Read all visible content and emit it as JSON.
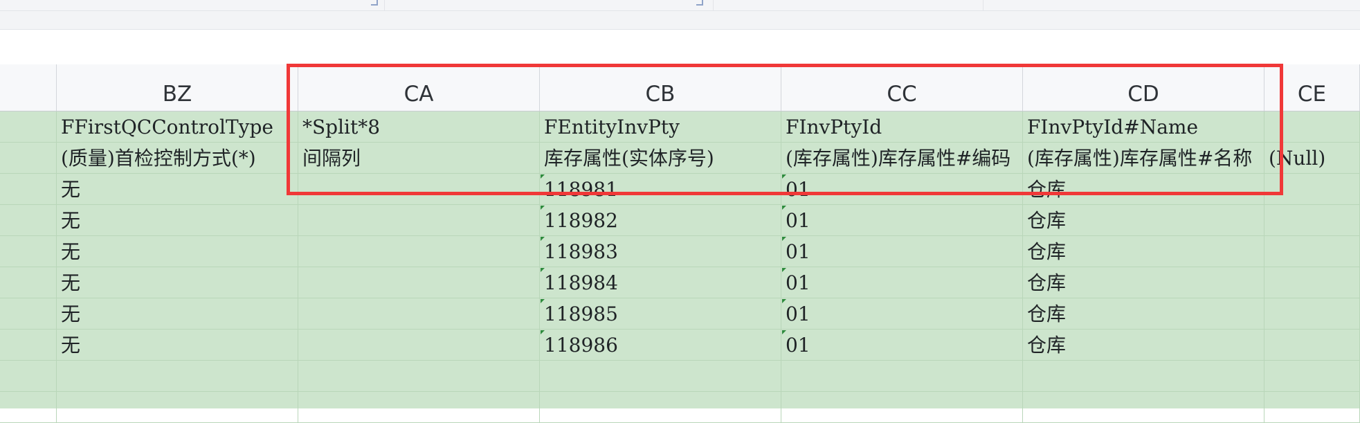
{
  "columns": [
    {
      "letter": "BZ"
    },
    {
      "letter": "CA"
    },
    {
      "letter": "CB"
    },
    {
      "letter": "CC"
    },
    {
      "letter": "CD"
    },
    {
      "letter": "CE"
    }
  ],
  "rows": [
    {
      "cells": [
        "FFirstQCControlType",
        "*Split*8",
        "FEntityInvPty",
        "FInvPtyId",
        "FInvPtyId#Name",
        ""
      ]
    },
    {
      "cells": [
        "(质量)首检控制方式(*)",
        "间隔列",
        "库存属性(实体序号)",
        "(库存属性)库存属性#编码",
        "(库存属性)库存属性#名称",
        "(Null)"
      ]
    },
    {
      "cells": [
        "无",
        "",
        "118981",
        "01",
        "仓库",
        ""
      ]
    },
    {
      "cells": [
        "无",
        "",
        "118982",
        "01",
        "仓库",
        ""
      ]
    },
    {
      "cells": [
        "无",
        "",
        "118983",
        "01",
        "仓库",
        ""
      ]
    },
    {
      "cells": [
        "无",
        "",
        "118984",
        "01",
        "仓库",
        ""
      ]
    },
    {
      "cells": [
        "无",
        "",
        "118985",
        "01",
        "仓库",
        ""
      ]
    },
    {
      "cells": [
        "无",
        "",
        "118986",
        "01",
        "仓库",
        ""
      ]
    },
    {
      "cells": [
        "",
        "",
        "",
        "",
        "",
        ""
      ]
    },
    {
      "cells": [
        "",
        "",
        "",
        "",
        "",
        ""
      ]
    }
  ],
  "colors": {
    "grid_fill": "#cde5cd",
    "highlight_border": "#f03838",
    "number_text_indicator": "#2e8b3d"
  }
}
